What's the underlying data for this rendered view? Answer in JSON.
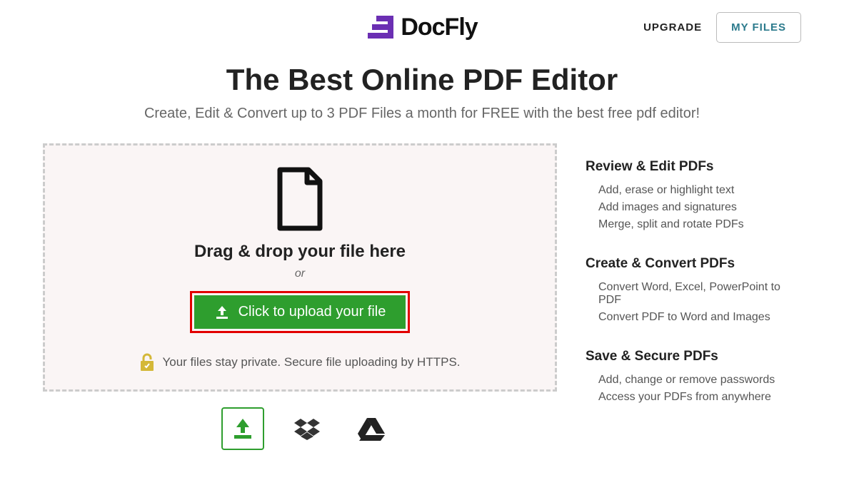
{
  "header": {
    "brand": "DocFly",
    "upgrade_label": "UPGRADE",
    "myfiles_label": "MY FILES"
  },
  "hero": {
    "title": "The Best Online PDF Editor",
    "subtitle": "Create, Edit & Convert up to 3 PDF Files a month for FREE with the best free pdf editor!"
  },
  "dropzone": {
    "drag_text": "Drag & drop your file here",
    "or_text": "or",
    "upload_label": "Click to upload your file",
    "secure_text": "Your files stay private. Secure file uploading by HTTPS."
  },
  "sidebar": {
    "sections": [
      {
        "heading": "Review & Edit PDFs",
        "items": [
          "Add, erase or highlight text",
          "Add images and signatures",
          "Merge, split and rotate PDFs"
        ]
      },
      {
        "heading": "Create & Convert PDFs",
        "items": [
          "Convert Word, Excel, PowerPoint to PDF",
          "Convert PDF to Word and Images"
        ]
      },
      {
        "heading": "Save & Secure PDFs",
        "items": [
          "Add, change or remove passwords",
          "Access your PDFs from anywhere"
        ]
      }
    ]
  }
}
